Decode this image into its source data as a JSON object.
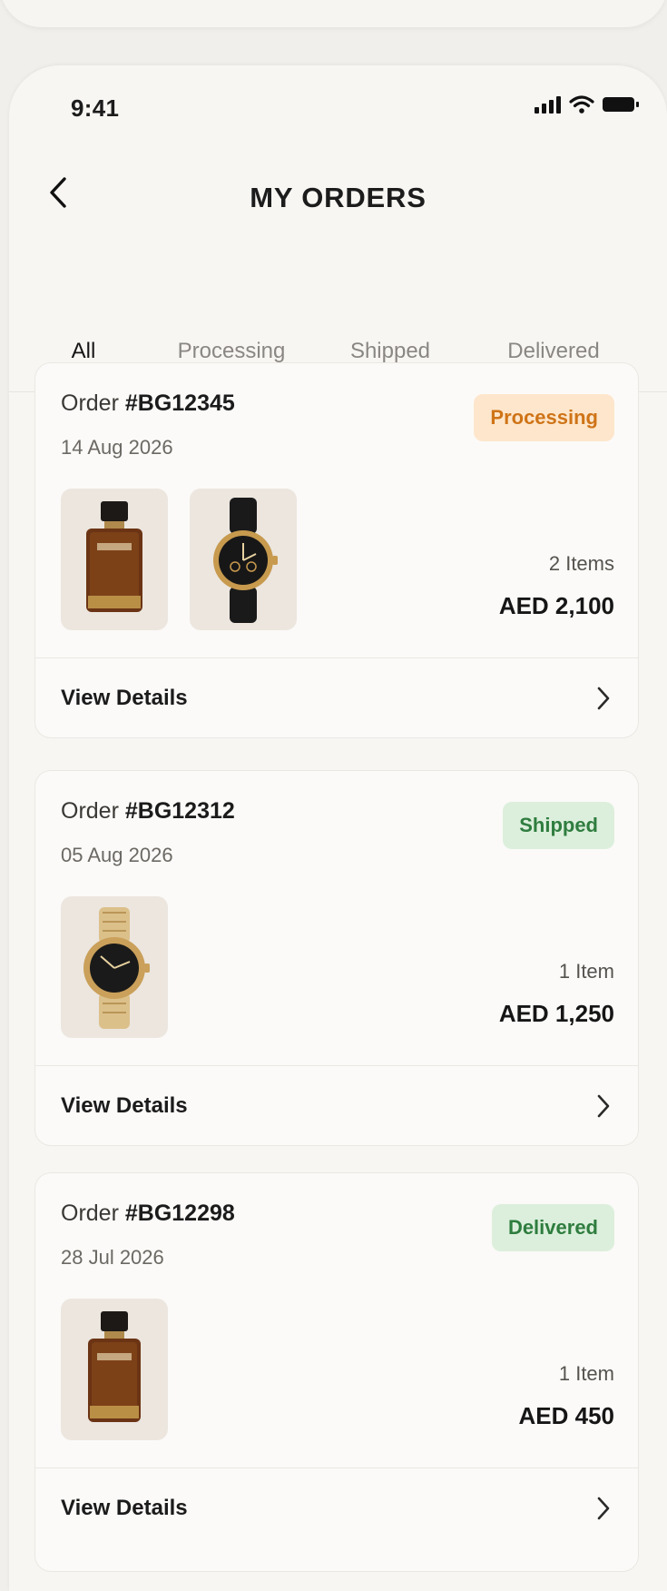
{
  "status_bar": {
    "time": "9:41",
    "icons": [
      "signal-icon",
      "wifi-icon",
      "battery-icon"
    ]
  },
  "header": {
    "title": "MY ORDERS",
    "back_icon": "chevron-left-icon"
  },
  "tabs": [
    {
      "label": "All",
      "active": true
    },
    {
      "label": "Processing",
      "active": false
    },
    {
      "label": "Shipped",
      "active": false
    },
    {
      "label": "Delivered",
      "active": false
    }
  ],
  "orders": [
    {
      "order_prefix": "Order ",
      "order_number": "#BG12345",
      "date": "14 Aug 2026",
      "status": "Processing",
      "items_label": "2 Items",
      "total": "AED 2,100",
      "thumbnails": [
        "perfume-bottle",
        "black-strap-watch"
      ],
      "action_label": "View Details"
    },
    {
      "order_prefix": "Order ",
      "order_number": "#BG12312",
      "date": "05 Aug 2026",
      "status": "Shipped",
      "items_label": "1 Item",
      "total": "AED 1,250",
      "thumbnails": [
        "gold-bracelet-watch"
      ],
      "action_label": "View Details"
    },
    {
      "order_prefix": "Order ",
      "order_number": "#BG12298",
      "date": "28 Jul 2026",
      "status": "Delivered",
      "items_label": "1 Item",
      "total": "AED 450",
      "thumbnails": [
        "perfume-bottle"
      ],
      "action_label": "View Details"
    }
  ],
  "colors": {
    "background": "#f8f6f3",
    "processing_badge_bg": "#fde6cc",
    "processing_badge_text": "#cf7417",
    "success_badge_bg": "#dcefdc",
    "success_badge_text": "#2f7d3f"
  }
}
